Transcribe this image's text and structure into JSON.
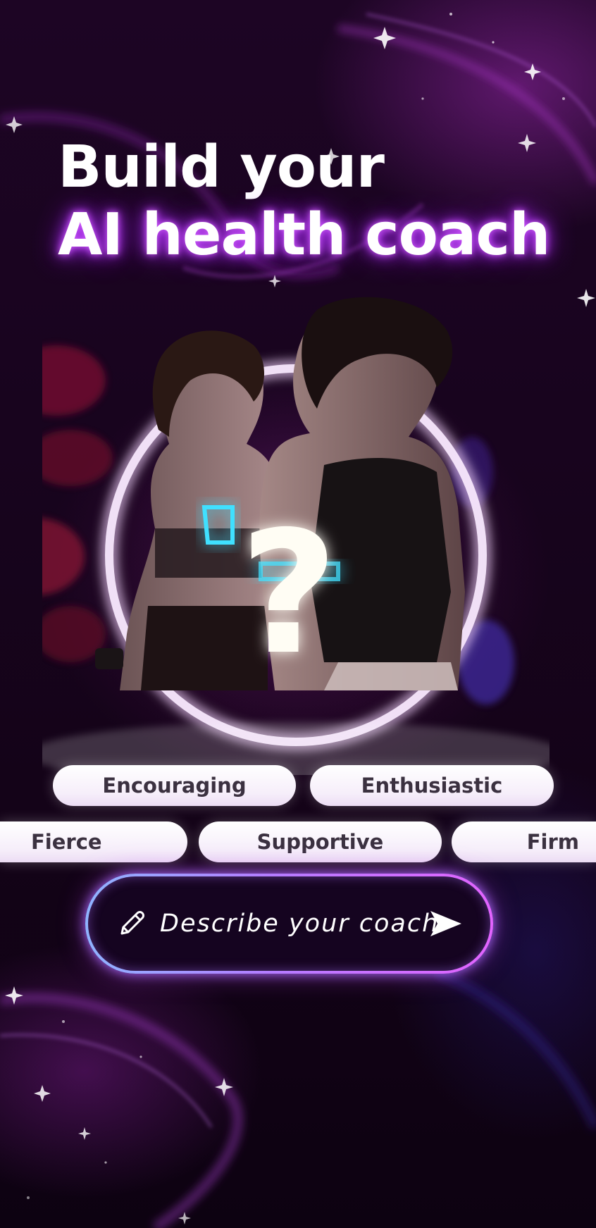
{
  "header": {
    "title_line1": "Build your",
    "title_line2": "AI health coach"
  },
  "hero": {
    "mystery_icon": "question-mark",
    "question_mark": "?"
  },
  "traits": {
    "row1": [
      "Encouraging",
      "Enthusiastic"
    ],
    "row2": [
      "Fierce",
      "Supportive",
      "Firm"
    ]
  },
  "describe": {
    "icon": "pencil-icon",
    "label": "Describe your coach",
    "send_icon": "send-arrow-icon"
  },
  "colors": {
    "background": "#12031a",
    "accent_purple": "#c13cff",
    "accent_blue": "#8fb4ff",
    "chip_background": "#ffffff",
    "chip_text": "#3b3140"
  }
}
